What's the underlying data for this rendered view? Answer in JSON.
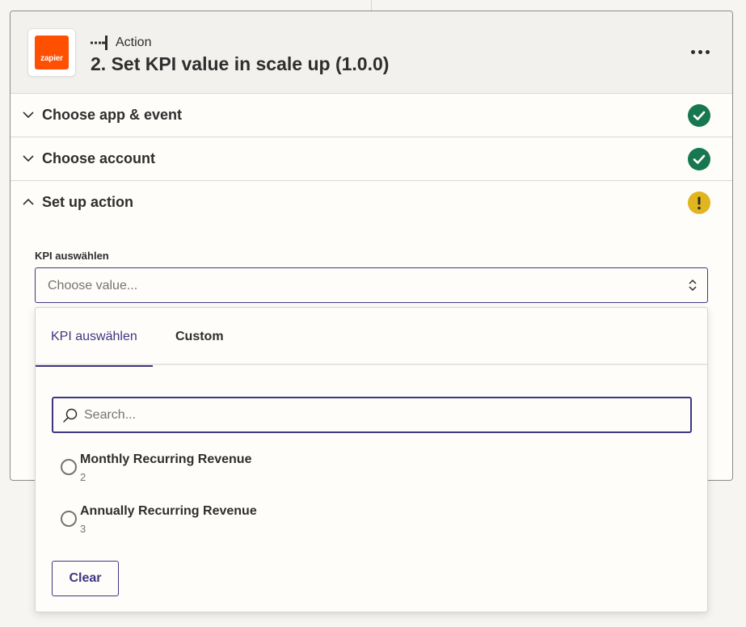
{
  "header": {
    "logo_text": "zapier",
    "step_type": "Action",
    "step_title": "2. Set KPI value in scale up (1.0.0)",
    "more_icon": "more-horizontal-icon"
  },
  "sections": [
    {
      "title": "Choose app & event",
      "status": "complete",
      "expanded": false
    },
    {
      "title": "Choose account",
      "status": "complete",
      "expanded": false
    },
    {
      "title": "Set up action",
      "status": "warning",
      "expanded": true
    }
  ],
  "form": {
    "field_label": "KPI auswählen",
    "select_placeholder": "Choose value..."
  },
  "dropdown": {
    "tabs": [
      {
        "label": "KPI auswählen",
        "active": true
      },
      {
        "label": "Custom",
        "active": false
      }
    ],
    "search_placeholder": "Search...",
    "options": [
      {
        "label": "Monthly Recurring Revenue",
        "value": "2"
      },
      {
        "label": "Annually Recurring Revenue",
        "value": "3"
      }
    ],
    "clear_label": "Clear"
  },
  "colors": {
    "brand_orange": "#ff4f00",
    "success_green": "#17774f",
    "warning_yellow": "#e1b520",
    "accent_purple": "#3d3782"
  }
}
